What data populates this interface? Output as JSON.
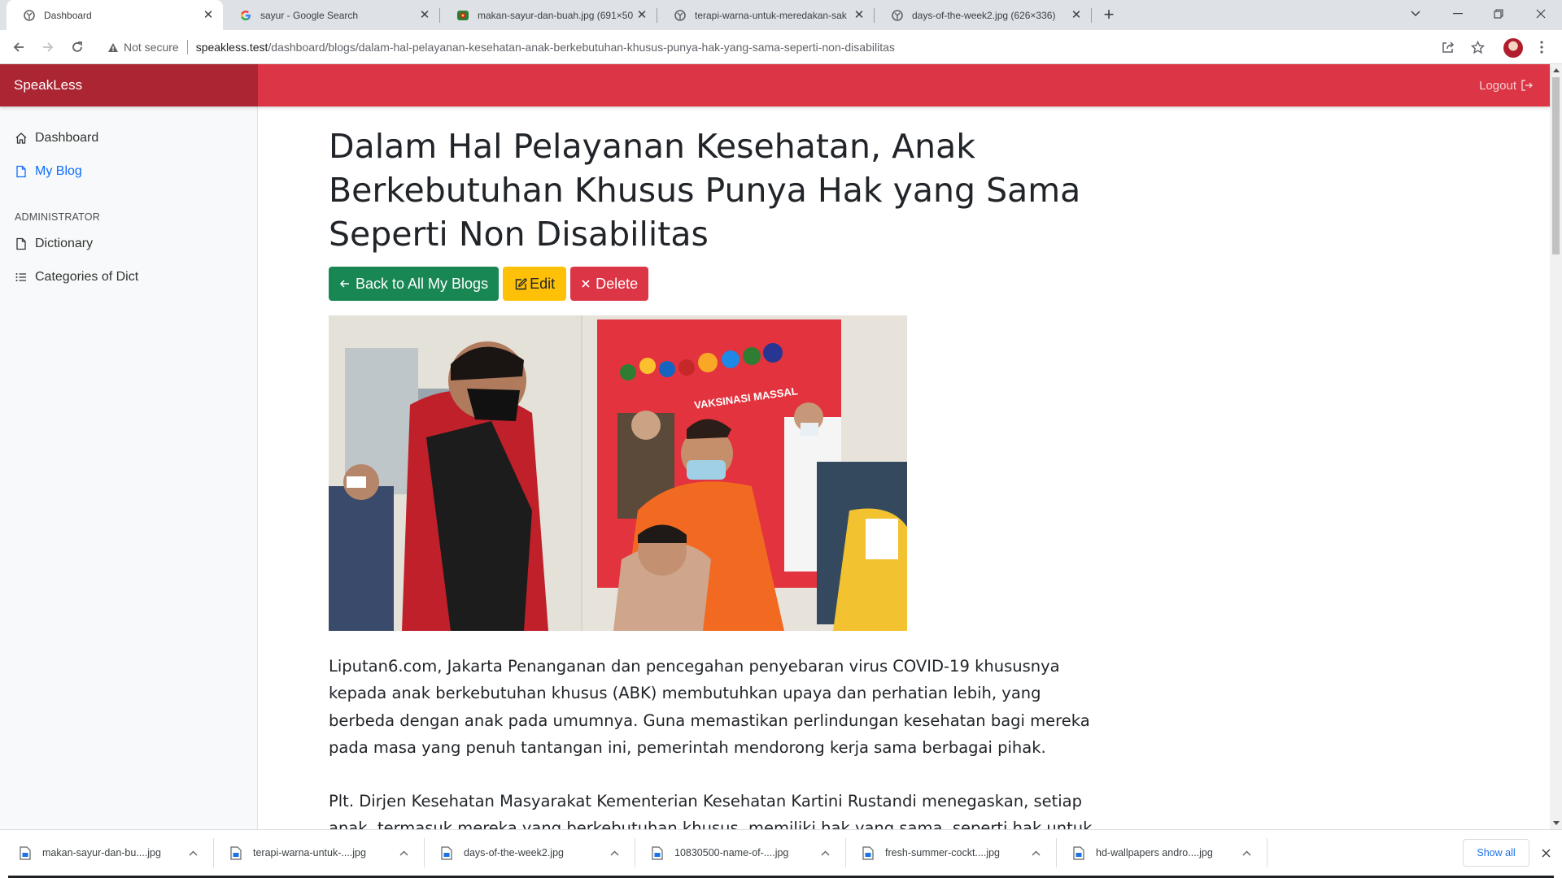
{
  "browser": {
    "tabs": [
      {
        "title": "Dashboard",
        "icon": "globe-icon",
        "active": true
      },
      {
        "title": "sayur - Google Search",
        "icon": "google-icon",
        "active": false
      },
      {
        "title": "makan-sayur-dan-buah.jpg (691×50",
        "icon": "image-icon",
        "active": false
      },
      {
        "title": "terapi-warna-untuk-meredakan-sak",
        "icon": "globe-icon",
        "active": false
      },
      {
        "title": "days-of-the-week2.jpg (626×336)",
        "icon": "globe-icon",
        "active": false
      }
    ],
    "security_label": "Not secure",
    "url_host": "speakless.test",
    "url_path": "/dashboard/blogs/dalam-hal-pelayanan-kesehatan-anak-berkebutuhan-khusus-punya-hak-yang-sama-seperti-non-disabilitas"
  },
  "app": {
    "brand": "SpeakLess",
    "logout_label": "Logout",
    "accent_color": "#dc3545",
    "sidebar": {
      "items": [
        {
          "label": "Dashboard",
          "icon": "house-icon",
          "active": false
        },
        {
          "label": "My Blog",
          "icon": "file-icon",
          "active": true
        }
      ],
      "admin_heading": "ADMINISTRATOR",
      "admin_items": [
        {
          "label": "Dictionary",
          "icon": "file-icon"
        },
        {
          "label": "Categories of Dict",
          "icon": "list-icon"
        }
      ]
    }
  },
  "post": {
    "title": "Dalam Hal Pelayanan Kesehatan, Anak Berkebutuhan Khusus Punya Hak yang Sama Seperti Non Disabilitas",
    "back_label": "Back to All My Blogs",
    "edit_label": "Edit",
    "delete_label": "Delete",
    "paragraphs": [
      "Liputan6.com, Jakarta Penanganan dan pencegahan penyebaran virus COVID-19 khususnya kepada anak berkebutuhan khusus (ABK) membutuhkan upaya dan perhatian lebih, yang berbeda dengan anak pada umumnya. Guna memastikan perlindungan kesehatan bagi mereka pada masa yang penuh tantangan ini, pemerintah mendorong kerja sama berbagai pihak.",
      "Plt. Dirjen Kesehatan Masyarakat Kementerian Kesehatan Kartini Rustandi menegaskan, setiap anak, termasuk mereka yang berkebutuhan khusus, memiliki hak yang sama, seperti hak untuk"
    ]
  },
  "downloads": {
    "files": [
      "makan-sayur-dan-bu....jpg",
      "terapi-warna-untuk-....jpg",
      "days-of-the-week2.jpg",
      "10830500-name-of-....jpg",
      "fresh-summer-cockt....jpg",
      "hd-wallpapers andro....jpg"
    ],
    "show_all_label": "Show all"
  }
}
